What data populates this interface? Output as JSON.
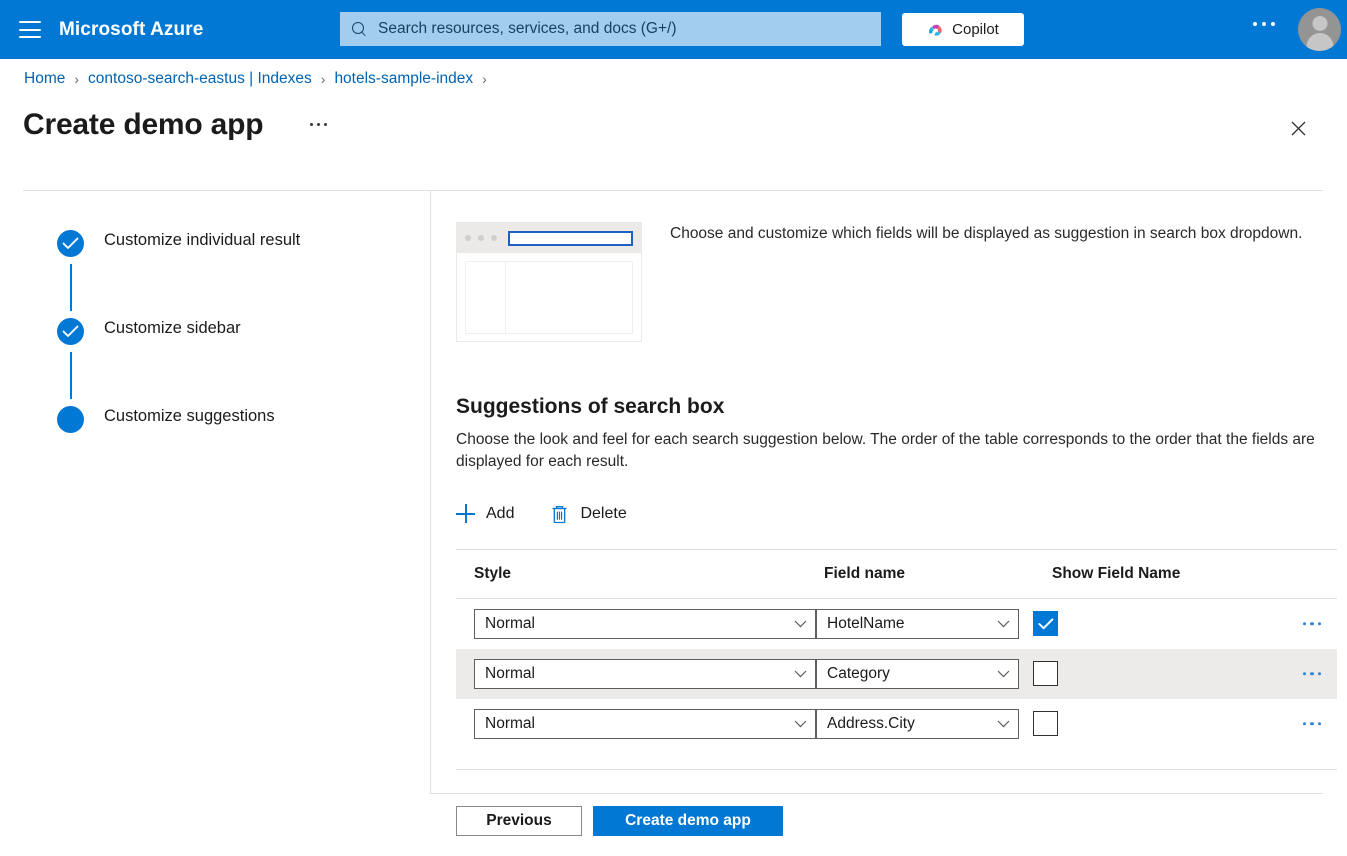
{
  "topbar": {
    "menu_icon": "hamburger-icon",
    "brand": "Microsoft Azure",
    "search_placeholder": "Search resources, services, and docs (G+/)",
    "search_icon": "search-icon",
    "copilot_label": "Copilot",
    "copilot_icon": "copilot-icon",
    "more_icon": "ellipsis-icon",
    "avatar_icon": "account-avatar-icon",
    "brand_color": "#0078d4"
  },
  "breadcrumb": {
    "items": [
      {
        "label": "Home"
      },
      {
        "label": "contoso-search-eastus | Indexes"
      },
      {
        "label": "hotels-sample-index"
      }
    ],
    "separator": "›"
  },
  "header": {
    "title": "Create demo app",
    "more_icon": "ellipsis-icon",
    "close_icon": "close-icon"
  },
  "steps": [
    {
      "label": "Customize individual result",
      "state": "complete",
      "icon": "check-icon"
    },
    {
      "label": "Customize sidebar",
      "state": "complete",
      "icon": "check-icon"
    },
    {
      "label": "Customize suggestions",
      "state": "current",
      "icon": "filled-dot-icon"
    }
  ],
  "preview": {
    "thumbnail_icon": "search-box-preview-thumbnail",
    "description": "Choose and customize which fields will be displayed as suggestion in search box dropdown."
  },
  "section": {
    "title": "Suggestions of search box",
    "description": "Choose the look and feel for each search suggestion below. The order of the table corresponds to the order that the fields are displayed for each result."
  },
  "commandbar": {
    "add_label": "Add",
    "add_icon": "plus-icon",
    "delete_label": "Delete",
    "delete_icon": "trash-icon"
  },
  "table": {
    "columns": [
      "Style",
      "Field name",
      "Show Field Name"
    ],
    "rows": [
      {
        "style": "Normal",
        "field_name": "HotelName",
        "show_field_name": true,
        "more_icon": "ellipsis-icon"
      },
      {
        "style": "Normal",
        "field_name": "Category",
        "show_field_name": false,
        "more_icon": "ellipsis-icon"
      },
      {
        "style": "Normal",
        "field_name": "Address.City",
        "show_field_name": false,
        "more_icon": "ellipsis-icon"
      }
    ]
  },
  "footer": {
    "previous_label": "Previous",
    "create_label": "Create demo app",
    "primary_color": "#0078d4"
  }
}
